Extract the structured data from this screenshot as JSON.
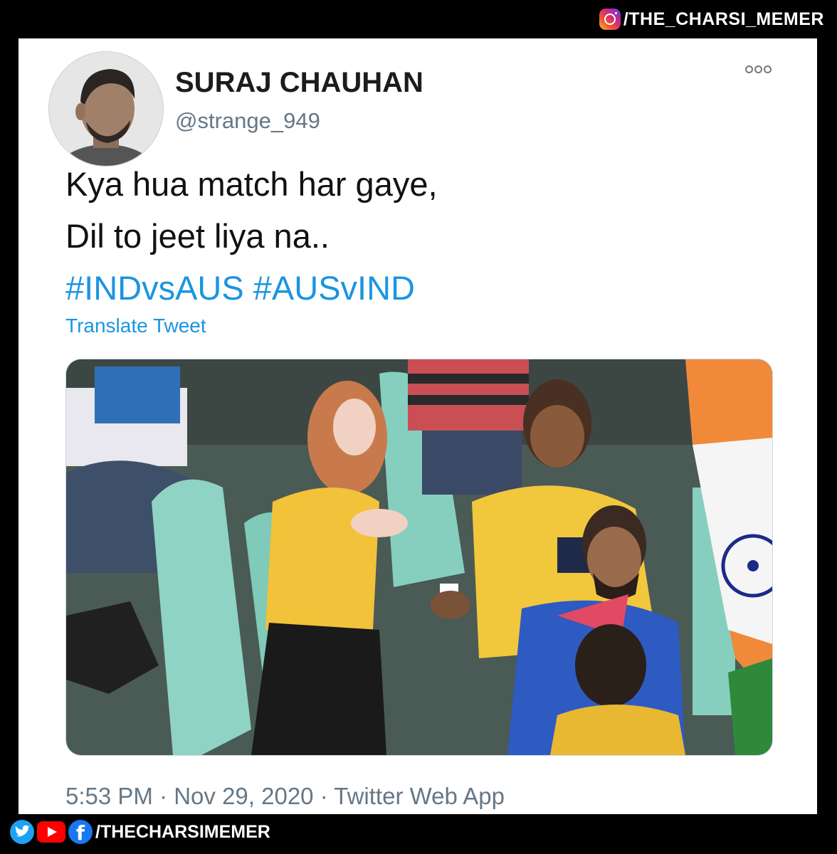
{
  "watermark": {
    "top_handle": "/THE_CHARSI_MEMER",
    "bottom_handle": "/THECHARSIMEMER",
    "icons": [
      "instagram-icon",
      "twitter-icon",
      "youtube-icon",
      "facebook-icon"
    ]
  },
  "tweet": {
    "author_name": "SURAJ CHAUHAN",
    "author_handle": "@strange_949",
    "text_line_1": "Kya hua match har gaye,",
    "text_line_2": "Dil to jeet liya na..",
    "hashtags": "#INDvsAUS #AUSvIND",
    "translate_label": "Translate Tweet",
    "timestamp": "5:53 PM · Nov 29, 2020 · Twitter Web App",
    "more_icon": "more-options-icon"
  },
  "colors": {
    "link": "#1b95e0",
    "muted": "#657786",
    "background": "#000000",
    "card": "#ffffff"
  }
}
